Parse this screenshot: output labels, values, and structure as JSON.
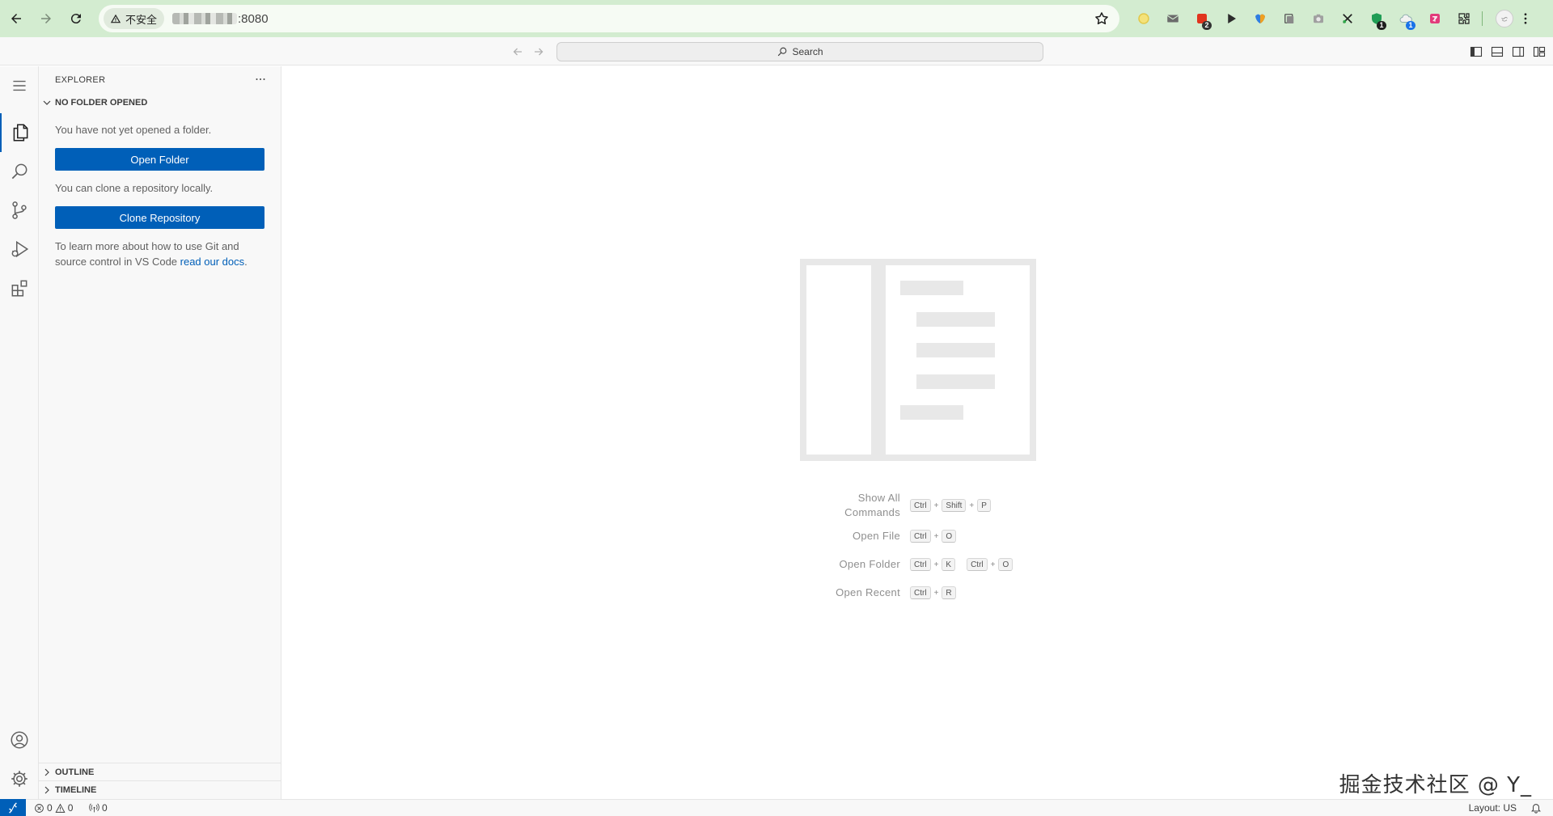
{
  "browser": {
    "security_label": "不安全",
    "url_suffix": ":8080",
    "extension_badges": [
      "2",
      "1",
      "1"
    ]
  },
  "titlebar": {
    "search_label": "Search"
  },
  "sidebar": {
    "title": "EXPLORER",
    "section_title": "NO FOLDER OPENED",
    "no_folder_text": "You have not yet opened a folder.",
    "open_folder_label": "Open Folder",
    "clone_text": "You can clone a repository locally.",
    "clone_label": "Clone Repository",
    "learn_text_1": "To learn more about how to use Git and",
    "learn_text_2": "source control in VS Code ",
    "docs_link": "read our docs",
    "docs_period": ".",
    "outline_label": "OUTLINE",
    "timeline_label": "TIMELINE"
  },
  "editor": {
    "shortcuts": [
      {
        "label_line1": "Show All",
        "label_line2": "Commands",
        "keys": [
          "Ctrl",
          "Shift",
          "P"
        ]
      },
      {
        "label": "Open File",
        "keys": [
          "Ctrl",
          "O"
        ]
      },
      {
        "label": "Open Folder",
        "keys": [
          "Ctrl",
          "K"
        ],
        "keys2": [
          "Ctrl",
          "O"
        ]
      },
      {
        "label": "Open Recent",
        "keys": [
          "Ctrl",
          "R"
        ]
      }
    ]
  },
  "statusbar": {
    "errors": "0",
    "warnings": "0",
    "ports": "0",
    "layout": "Layout: US"
  },
  "watermark": "掘金技术社区 @ Y_",
  "colors": {
    "accent": "#005fb8",
    "browser_bar": "#d3ecd0",
    "panel": "#f8f8f8"
  },
  "icons": {
    "browser": [
      "back-arrow-icon",
      "forward-arrow-icon",
      "reload-icon",
      "warning-icon",
      "star-icon",
      "kebab-menu-icon"
    ],
    "extensions": [
      "circle-extension-icon",
      "mail-extension-icon",
      "red-extension-icon",
      "play-extension-icon",
      "shield-extension-icon",
      "copy-extension-icon",
      "camera-extension-icon",
      "scissors-extension-icon",
      "green-extension-icon",
      "cloud-extension-icon",
      "translate-extension-icon",
      "puzzle-icon",
      "profile-avatar-icon"
    ],
    "activity": [
      "menu-icon",
      "files-icon",
      "search-icon",
      "source-control-icon",
      "run-debug-icon",
      "extensions-icon",
      "account-icon",
      "manage-gear-icon"
    ]
  }
}
